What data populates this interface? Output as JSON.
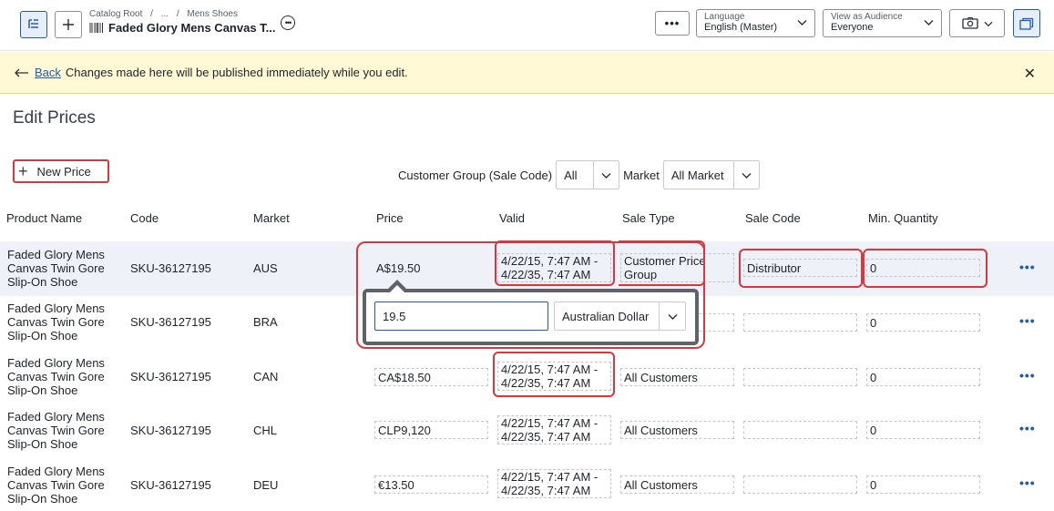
{
  "header": {
    "breadcrumb": [
      "Catalog Root",
      "/",
      "...",
      "/",
      "Mens Shoes"
    ],
    "product_title": "Faded Glory Mens Canvas T...",
    "more_label": "•••",
    "language": {
      "label": "Language",
      "value": "English (Master)"
    },
    "audience": {
      "label": "View as Audience",
      "value": "Everyone"
    }
  },
  "banner": {
    "back_label": "Back",
    "message": "Changes made here will be published immediately while you edit."
  },
  "page_title": "Edit Prices",
  "new_price_label": "New Price",
  "filters": {
    "customer_group_label": "Customer Group (Sale Code)",
    "customer_group_value": "All",
    "market_label": "Market",
    "market_value": "All Market"
  },
  "table": {
    "headers": [
      "Product Name",
      "Code",
      "Market",
      "Price",
      "Valid",
      "Sale Type",
      "Sale Code",
      "Min. Quantity"
    ],
    "rows": [
      {
        "name": "Faded Glory Mens Canvas Twin Gore Slip-On Shoe",
        "code": "SKU-36127195",
        "market": "AUS",
        "price": "A$19.50",
        "valid_from": "4/22/15, 7:47 AM -",
        "valid_to": "4/22/35, 7:47 AM",
        "sale_type": "Customer Price Group",
        "sale_code": "Distributor",
        "min_qty": "0"
      },
      {
        "name": "Faded Glory Mens Canvas Twin Gore Slip-On Shoe",
        "code": "SKU-36127195",
        "market": "BRA",
        "price": "",
        "valid_from": "",
        "valid_to": "",
        "sale_type": "",
        "sale_code": "",
        "min_qty": "0"
      },
      {
        "name": "Faded Glory Mens Canvas Twin Gore Slip-On Shoe",
        "code": "SKU-36127195",
        "market": "CAN",
        "price": "CA$18.50",
        "valid_from": "4/22/15, 7:47 AM -",
        "valid_to": "4/22/35, 7:47 AM",
        "sale_type": "All Customers",
        "sale_code": "",
        "min_qty": "0"
      },
      {
        "name": "Faded Glory Mens Canvas Twin Gore Slip-On Shoe",
        "code": "SKU-36127195",
        "market": "CHL",
        "price": "CLP9,120",
        "valid_from": "4/22/15, 7:47 AM -",
        "valid_to": "4/22/35, 7:47 AM",
        "sale_type": "All Customers",
        "sale_code": "",
        "min_qty": "0"
      },
      {
        "name": "Faded Glory Mens Canvas Twin Gore Slip-On Shoe",
        "code": "SKU-36127195",
        "market": "DEU",
        "price": "€13.50",
        "valid_from": "4/22/15, 7:47 AM -",
        "valid_to": "4/22/35, 7:47 AM",
        "sale_type": "All Customers",
        "sale_code": "",
        "min_qty": "0"
      }
    ],
    "row_menu_label": "•••"
  },
  "popover": {
    "price_value": "19.5",
    "currency": "Australian Dollar"
  },
  "colors": {
    "accent": "#1e5bb8",
    "annotation": "#d9373f",
    "banner_bg": "#fff9d6",
    "row_highlight": "#eef1f7"
  },
  "icons": [
    "tree-view-icon",
    "plus-icon",
    "barcode-icon",
    "more-icon",
    "chevron-down-icon",
    "camera-icon",
    "copy-icon",
    "arrow-left-icon",
    "close-icon",
    "kebab-icon"
  ]
}
